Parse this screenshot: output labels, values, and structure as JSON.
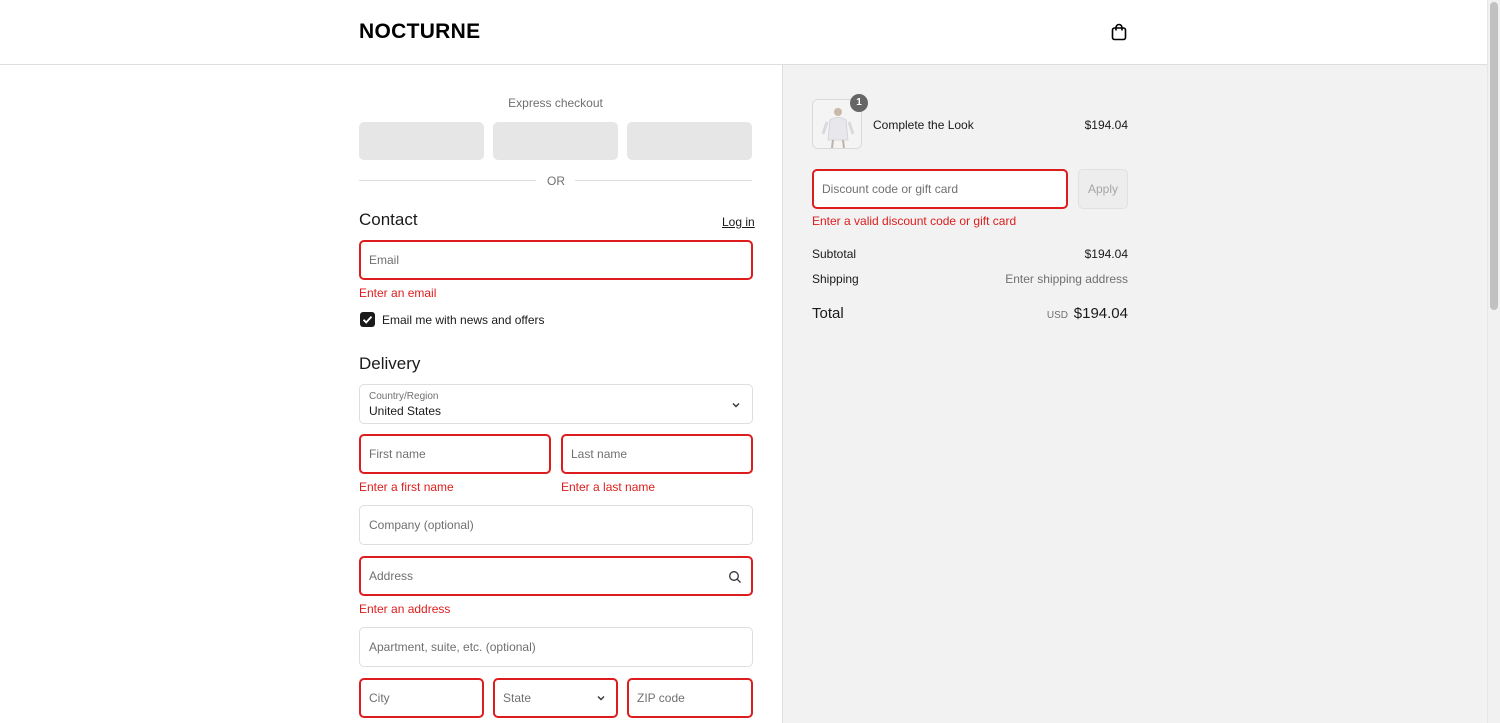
{
  "header": {
    "logo": "NOCTURNE",
    "cart_icon": "shopping-bag-icon"
  },
  "express": {
    "label": "Express checkout",
    "divider": "OR"
  },
  "contact": {
    "title": "Contact",
    "login": "Log in",
    "email_placeholder": "Email",
    "email_error": "Enter an email",
    "newsletter_label": "Email me with news and offers",
    "newsletter_checked": true
  },
  "delivery": {
    "title": "Delivery",
    "country_label": "Country/Region",
    "country_value": "United States",
    "first_name_placeholder": "First name",
    "first_name_error": "Enter a first name",
    "last_name_placeholder": "Last name",
    "last_name_error": "Enter a last name",
    "company_placeholder": "Company (optional)",
    "address_placeholder": "Address",
    "address_error": "Enter an address",
    "apartment_placeholder": "Apartment, suite, etc. (optional)",
    "city_placeholder": "City",
    "state_placeholder": "State",
    "zip_placeholder": "ZIP code"
  },
  "summary": {
    "product": {
      "name": "Complete the Look",
      "price": "$194.04",
      "quantity": "1"
    },
    "discount_placeholder": "Discount code or gift card",
    "apply_label": "Apply",
    "discount_error": "Enter a valid discount code or gift card",
    "subtotal_label": "Subtotal",
    "subtotal_value": "$194.04",
    "shipping_label": "Shipping",
    "shipping_value": "Enter shipping address",
    "total_label": "Total",
    "currency": "USD",
    "total_value": "$194.04"
  },
  "colors": {
    "error": "#dd1d1d",
    "summary_bg": "#f2f2f2",
    "text": "#1a1a1a"
  }
}
